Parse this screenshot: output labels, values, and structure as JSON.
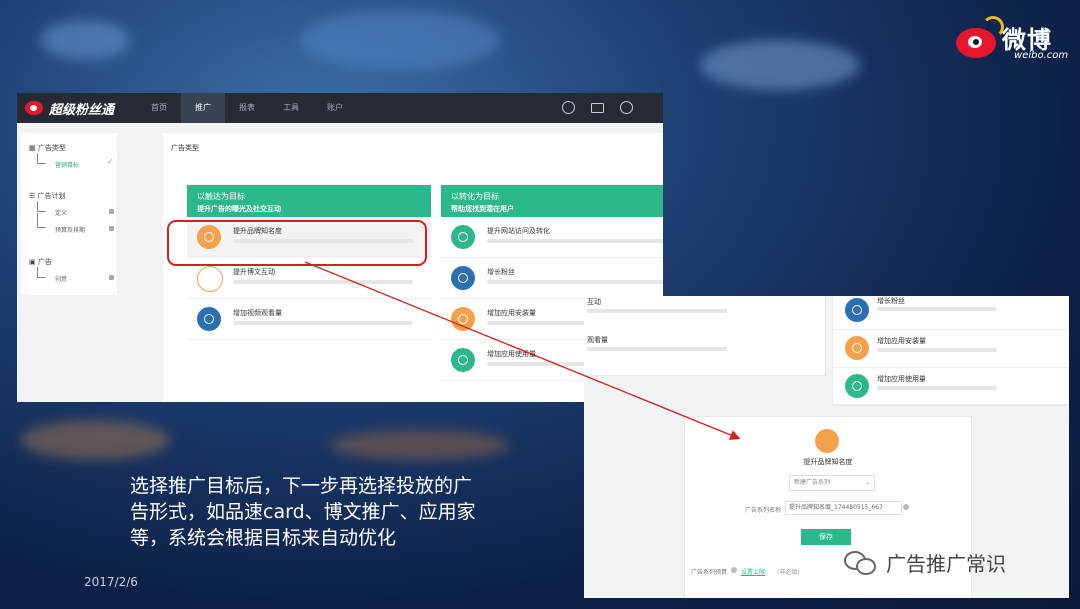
{
  "logo": {
    "brand": "微博",
    "domain": "weibo.com"
  },
  "app": {
    "brand": "超级粉丝通",
    "nav": [
      "首页",
      "推广",
      "报表",
      "工具",
      "账户"
    ],
    "nav_active": "推广"
  },
  "sidebar": {
    "sections": [
      {
        "label": "广告类型",
        "subs": [
          "营销目标"
        ]
      },
      {
        "label": "广告计划",
        "subs": [
          "定义",
          "预算及排期"
        ]
      },
      {
        "label": "广告",
        "subs": [
          "创意"
        ]
      }
    ]
  },
  "main": {
    "title": "广告类型",
    "left_panel": {
      "heading": "以触达为目标",
      "subheading": "提升广告的曝光及社交互动",
      "items": [
        "提升品牌知名度",
        "提升博文互动",
        "增加视频观看量"
      ]
    },
    "right_panel": {
      "heading": "以转化为目标",
      "subheading": "帮助您找到潜在用户",
      "items": [
        "提升网站访问及转化",
        "增长粉丝",
        "增加应用安装量",
        "增加应用使用量"
      ]
    }
  },
  "detail": {
    "partial_left": [
      "互动",
      "观看量"
    ],
    "right_items": [
      "增长粉丝",
      "增加应用安装量",
      "增加应用使用量"
    ],
    "selected_goal": "提升品牌知名度",
    "dropdown_value": "新建广告系列",
    "name_label": "广告系列名称",
    "name_value": "提升品牌知名度_174480515_667",
    "save_button": "保存",
    "budget_label": "广告系列预算",
    "budget_link": "设置上限",
    "budget_hint": "(非必填)"
  },
  "caption": "选择推广目标后，下一步再选择投放的广告形式，如品速card、博文推广、应用家等，系统会根据目标来自动优化",
  "date": "2017/2/6",
  "watermark": "广告推广常识",
  "colors": {
    "accent": "#2db88b",
    "highlight": "#d81e1e",
    "topbar": "#252a34"
  }
}
